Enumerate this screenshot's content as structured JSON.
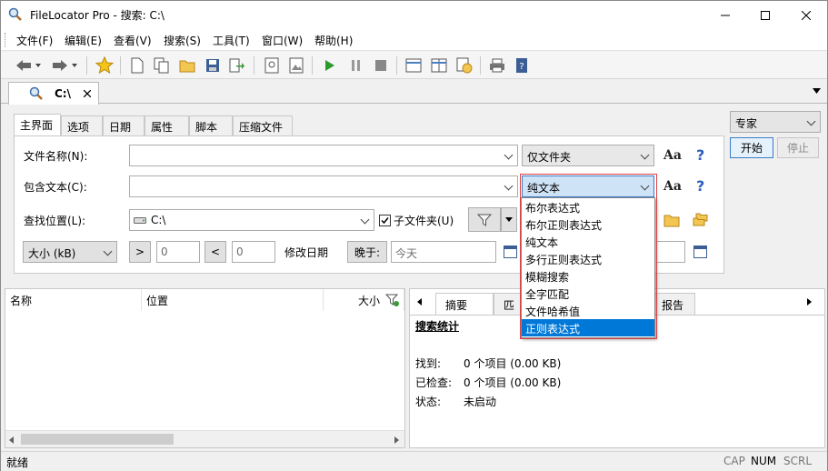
{
  "window": {
    "title": "FileLocator Pro - 搜索: C:\\",
    "min_icon": "minimize-icon",
    "max_icon": "maximize-icon",
    "close_icon": "close-icon"
  },
  "menu": [
    "文件(F)",
    "编辑(E)",
    "查看(V)",
    "搜索(S)",
    "工具(T)",
    "窗口(W)",
    "帮助(H)"
  ],
  "doc_tab": {
    "label": "C:\\",
    "icon": "search-icon"
  },
  "sub_tabs": [
    "主界面",
    "选项",
    "日期",
    "属性",
    "脚本",
    "压缩文件"
  ],
  "form": {
    "filename_label": "文件名称(N):",
    "filename_value": "",
    "filename_mode": "仅文件夹",
    "containing_label": "包含文本(C):",
    "containing_value": "",
    "containing_mode": "纯文本",
    "location_label": "查找位置(L):",
    "location_value": "C:\\",
    "subfolders_label": "子文件夹(U)",
    "size_label": "大小 (kB)",
    "gt": ">",
    "gt_value": "0",
    "lt": "<",
    "lt_value": "0",
    "modified_label": "修改日期",
    "later_label": "晚于:",
    "later_value": "今天",
    "aa": "Aa",
    "help": "?"
  },
  "right_panel": {
    "mode_value": "专家",
    "start_label": "开始",
    "stop_label": "停止"
  },
  "dropdown": [
    "布尔表达式",
    "布尔正则表达式",
    "纯文本",
    "多行正则表达式",
    "模糊搜索",
    "全字匹配",
    "文件哈希值",
    "正则表达式"
  ],
  "results": {
    "col_name": "名称",
    "col_location": "位置",
    "col_size": "大小"
  },
  "report": {
    "tabs": [
      "摘要",
      "匹",
      "报告"
    ],
    "heading": "搜索统计",
    "rows": [
      {
        "k": "找到:",
        "v": "0 个项目 (0.00 KB)"
      },
      {
        "k": "已检查:",
        "v": "0 个项目 (0.00 KB)"
      },
      {
        "k": "状态:",
        "v": "未启动"
      }
    ]
  },
  "status": {
    "text": "就绪",
    "cap": "CAP",
    "num": "NUM",
    "scrl": "SCRL"
  }
}
